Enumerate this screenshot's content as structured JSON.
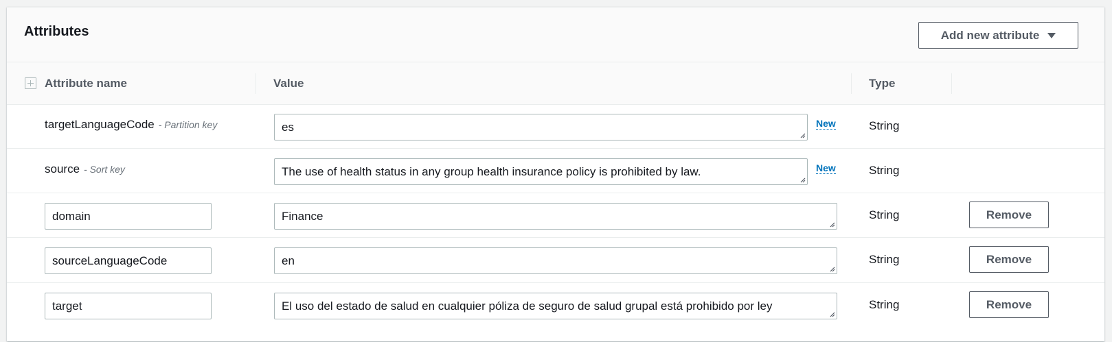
{
  "panel": {
    "title": "Attributes",
    "add_button_label": "Add new attribute"
  },
  "table": {
    "headers": {
      "name": "Attribute name",
      "value": "Value",
      "type": "Type"
    },
    "rows": [
      {
        "name": "targetLanguageCode",
        "key_type": "- Partition key",
        "value": "es",
        "badge": "New",
        "type": "String",
        "editable_name": false
      },
      {
        "name": "source",
        "key_type": "- Sort key",
        "value": "The use of health status in any group health insurance policy is prohibited by law.",
        "badge": "New",
        "type": "String",
        "editable_name": false
      },
      {
        "name": "domain",
        "value": "Finance",
        "type": "String",
        "editable_name": true,
        "remove_label": "Remove"
      },
      {
        "name": "sourceLanguageCode",
        "value": "en",
        "type": "String",
        "editable_name": true,
        "remove_label": "Remove"
      },
      {
        "name": "target",
        "value": "El uso del estado de salud en cualquier póliza de seguro de salud grupal está prohibido por ley",
        "type": "String",
        "editable_name": true,
        "remove_label": "Remove"
      }
    ]
  },
  "colors": {
    "link": "#0073bb",
    "button_text": "#545b64",
    "border": "#aab7b8"
  }
}
